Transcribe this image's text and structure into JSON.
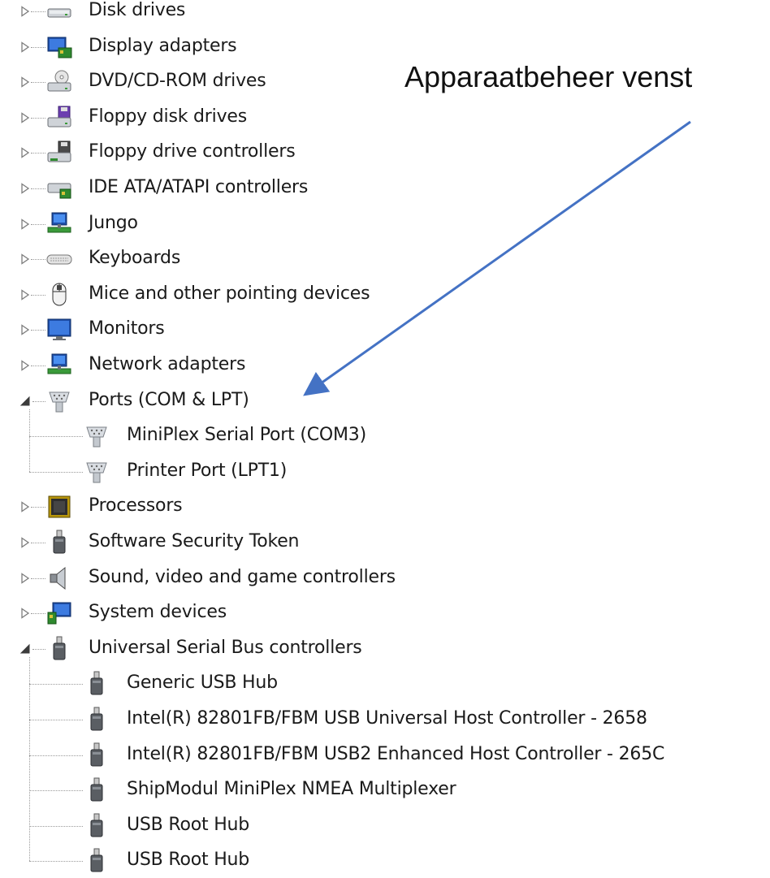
{
  "annotation": {
    "text": "Apparaatbeheer venst",
    "arrow_color": "#4472c4"
  },
  "tree": [
    {
      "label": "Disk drives",
      "icon": "disk-drive-icon",
      "state": "collapsed",
      "level": 0
    },
    {
      "label": "Display adapters",
      "icon": "display-adapter-icon",
      "state": "collapsed",
      "level": 0
    },
    {
      "label": "DVD/CD-ROM drives",
      "icon": "dvd-drive-icon",
      "state": "collapsed",
      "level": 0
    },
    {
      "label": "Floppy disk drives",
      "icon": "floppy-drive-icon",
      "state": "collapsed",
      "level": 0
    },
    {
      "label": "Floppy drive controllers",
      "icon": "floppy-controller-icon",
      "state": "collapsed",
      "level": 0
    },
    {
      "label": "IDE ATA/ATAPI controllers",
      "icon": "ide-controller-icon",
      "state": "collapsed",
      "level": 0
    },
    {
      "label": "Jungo",
      "icon": "network-icon",
      "state": "collapsed",
      "level": 0
    },
    {
      "label": "Keyboards",
      "icon": "keyboard-icon",
      "state": "collapsed",
      "level": 0
    },
    {
      "label": "Mice and other pointing devices",
      "icon": "mouse-icon",
      "state": "collapsed",
      "level": 0
    },
    {
      "label": "Monitors",
      "icon": "monitor-icon",
      "state": "collapsed",
      "level": 0
    },
    {
      "label": "Network adapters",
      "icon": "network-icon",
      "state": "collapsed",
      "level": 0
    },
    {
      "label": "Ports (COM & LPT)",
      "icon": "port-icon",
      "state": "expanded",
      "level": 0
    },
    {
      "label": "MiniPlex Serial Port (COM3)",
      "icon": "port-icon",
      "state": "leaf",
      "level": 1
    },
    {
      "label": "Printer Port (LPT1)",
      "icon": "port-icon",
      "state": "leaf",
      "level": 1,
      "last": true
    },
    {
      "label": "Processors",
      "icon": "processor-icon",
      "state": "collapsed",
      "level": 0
    },
    {
      "label": "Software Security Token",
      "icon": "usb-icon",
      "state": "collapsed",
      "level": 0
    },
    {
      "label": "Sound, video and game controllers",
      "icon": "speaker-icon",
      "state": "collapsed",
      "level": 0
    },
    {
      "label": "System devices",
      "icon": "system-devices-icon",
      "state": "collapsed",
      "level": 0
    },
    {
      "label": "Universal Serial Bus controllers",
      "icon": "usb-icon",
      "state": "expanded",
      "level": 0
    },
    {
      "label": "Generic USB Hub",
      "icon": "usb-icon",
      "state": "leaf",
      "level": 1
    },
    {
      "label": "Intel(R) 82801FB/FBM USB Universal Host Controller - 2658",
      "icon": "usb-icon",
      "state": "leaf",
      "level": 1
    },
    {
      "label": "Intel(R) 82801FB/FBM USB2 Enhanced Host Controller - 265C",
      "icon": "usb-icon",
      "state": "leaf",
      "level": 1
    },
    {
      "label": "ShipModul MiniPlex NMEA Multiplexer",
      "icon": "usb-icon",
      "state": "leaf",
      "level": 1
    },
    {
      "label": "USB Root Hub",
      "icon": "usb-icon",
      "state": "leaf",
      "level": 1
    },
    {
      "label": "USB Root Hub",
      "icon": "usb-icon",
      "state": "leaf",
      "level": 1,
      "last": true
    }
  ]
}
